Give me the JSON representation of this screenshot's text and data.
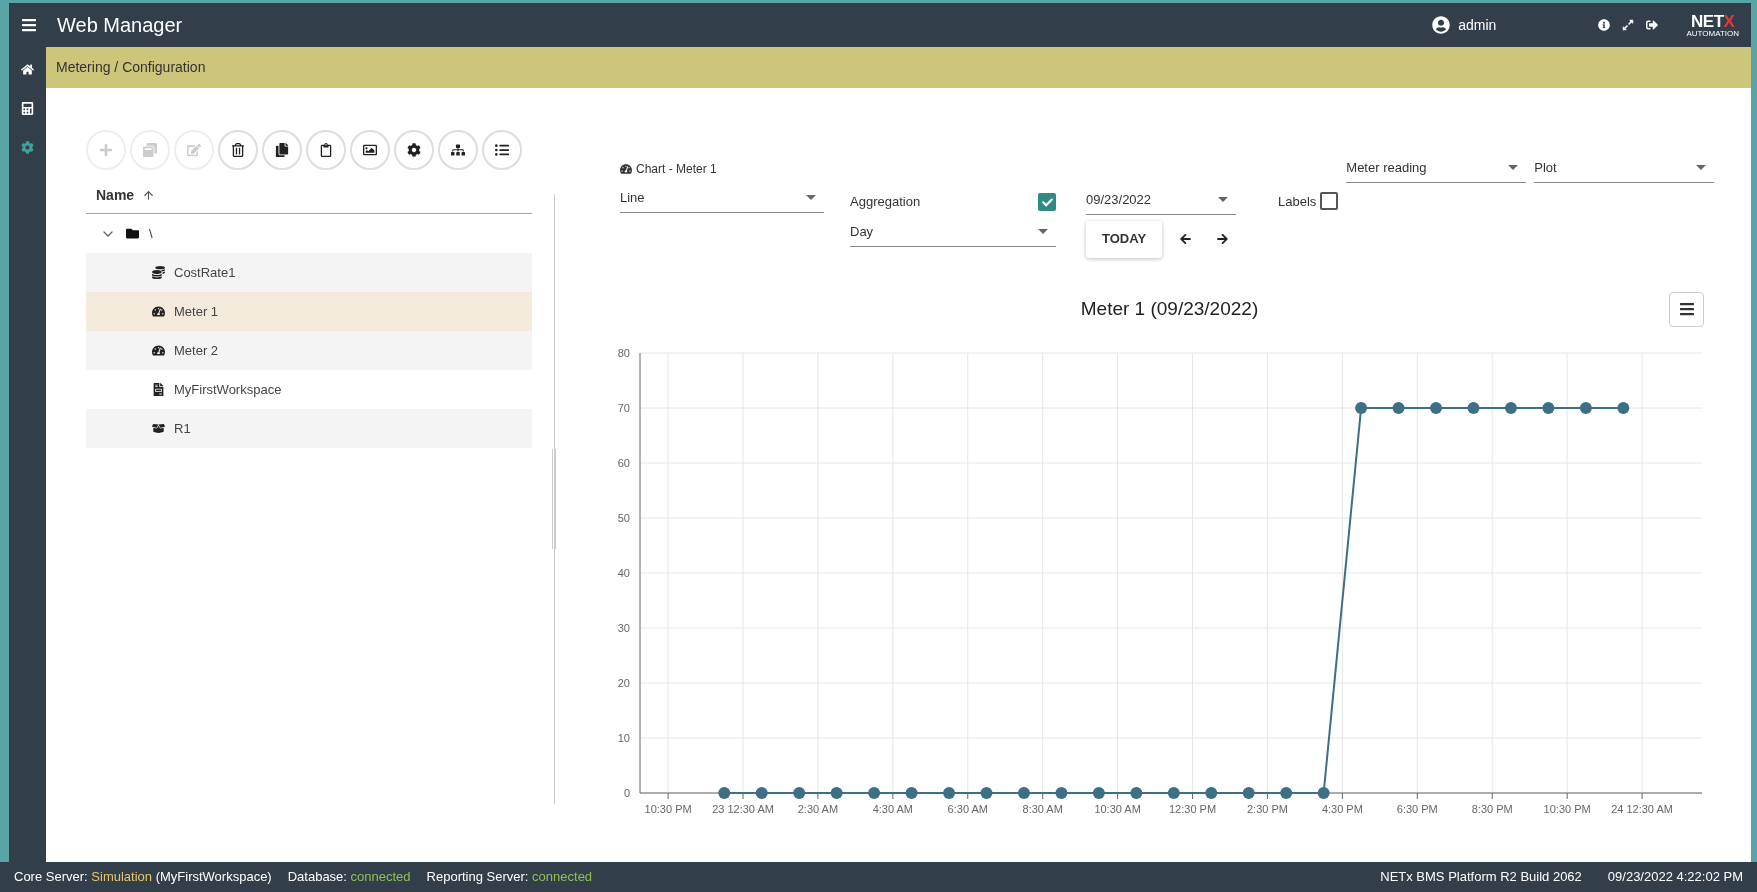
{
  "app_bar": {
    "title": "Web Manager",
    "user": "admin",
    "logo": {
      "name": "NET",
      "accent": "X",
      "tagline": "AUTOMATION"
    }
  },
  "sidebar": {
    "items": [
      {
        "kind": "home",
        "selected": false
      },
      {
        "kind": "calculator",
        "selected": false
      },
      {
        "kind": "settings",
        "selected": true
      }
    ]
  },
  "breadcrumb": "Metering / Configuration",
  "toolbar": {
    "buttons": [
      {
        "kind": "add",
        "disabled": true
      },
      {
        "kind": "duplicate",
        "disabled": true
      },
      {
        "kind": "edit",
        "disabled": true
      },
      {
        "kind": "delete",
        "disabled": false
      },
      {
        "kind": "copy",
        "disabled": false
      },
      {
        "kind": "paste",
        "disabled": false
      },
      {
        "kind": "image",
        "disabled": false
      },
      {
        "kind": "settings",
        "disabled": false
      },
      {
        "kind": "hierarchy",
        "disabled": false
      },
      {
        "kind": "list",
        "disabled": false
      }
    ]
  },
  "tree": {
    "column": "Name",
    "root": {
      "label": "\\",
      "expanded": true,
      "children": [
        {
          "label": "CostRate1",
          "kind": "cost",
          "selected": false
        },
        {
          "label": "Meter 1",
          "kind": "meter",
          "selected": true
        },
        {
          "label": "Meter 2",
          "kind": "meter",
          "selected": false
        },
        {
          "label": "MyFirstWorkspace",
          "kind": "workspace",
          "selected": false
        },
        {
          "label": "R1",
          "kind": "box",
          "selected": false
        }
      ]
    }
  },
  "chart_panel": {
    "title": "Chart - Meter 1",
    "chart_type": "Line",
    "aggregation": {
      "label": "Aggregation",
      "checked": true,
      "value": "Day"
    },
    "date": "09/23/2022",
    "today_button": "TODAY",
    "labels": {
      "label": "Labels",
      "checked": false
    },
    "value_select": "Meter reading",
    "mode_select": "Plot",
    "chart_data": {
      "type": "line",
      "title": "Meter 1 (09/23/2022)",
      "grid": true,
      "x": [
        "2022-09-23T00:00",
        "2022-09-23T01:00",
        "2022-09-23T02:00",
        "2022-09-23T03:00",
        "2022-09-23T04:00",
        "2022-09-23T05:00",
        "2022-09-23T06:00",
        "2022-09-23T07:00",
        "2022-09-23T08:00",
        "2022-09-23T09:00",
        "2022-09-23T10:00",
        "2022-09-23T11:00",
        "2022-09-23T12:00",
        "2022-09-23T13:00",
        "2022-09-23T14:00",
        "2022-09-23T15:00",
        "2022-09-23T16:00",
        "2022-09-23T17:00",
        "2022-09-23T18:00",
        "2022-09-23T19:00",
        "2022-09-23T20:00",
        "2022-09-23T21:00",
        "2022-09-23T22:00",
        "2022-09-23T23:00",
        "2022-09-24T00:00"
      ],
      "series": [
        {
          "color": "#3d6f87",
          "marker": "circle",
          "values": [
            0,
            0,
            0,
            0,
            0,
            0,
            0,
            0,
            0,
            0,
            0,
            0,
            0,
            0,
            0,
            0,
            0,
            70,
            70,
            70,
            70,
            70,
            70,
            70,
            70
          ]
        }
      ],
      "xlim": [
        "2022-09-22T21:45",
        "2022-09-24T02:06"
      ],
      "ylim": [
        0,
        80
      ],
      "xticks": [
        {
          "value": "2022-09-22T22:30",
          "label": "10:30 PM"
        },
        {
          "value": "2022-09-23T00:30",
          "label": "23 12:30 AM"
        },
        {
          "value": "2022-09-23T02:30",
          "label": "2:30 AM"
        },
        {
          "value": "2022-09-23T04:30",
          "label": "4:30 AM"
        },
        {
          "value": "2022-09-23T06:30",
          "label": "6:30 AM"
        },
        {
          "value": "2022-09-23T08:30",
          "label": "8:30 AM"
        },
        {
          "value": "2022-09-23T10:30",
          "label": "10:30 AM"
        },
        {
          "value": "2022-09-23T12:30",
          "label": "12:30 PM"
        },
        {
          "value": "2022-09-23T14:30",
          "label": "2:30 PM"
        },
        {
          "value": "2022-09-23T16:30",
          "label": "4:30 PM"
        },
        {
          "value": "2022-09-23T18:30",
          "label": "6:30 PM"
        },
        {
          "value": "2022-09-23T20:30",
          "label": "8:30 PM"
        },
        {
          "value": "2022-09-23T22:30",
          "label": "10:30 PM"
        },
        {
          "value": "2022-09-24T00:30",
          "label": "24 12:30 AM"
        }
      ],
      "yticks": [
        0,
        10,
        20,
        30,
        40,
        50,
        60,
        70,
        80
      ]
    }
  },
  "status_bar": {
    "items": [
      {
        "label": "Core Server:",
        "value": "Simulation",
        "extra": "(MyFirstWorkspace)",
        "color": "#e6c66a"
      },
      {
        "label": "Database:",
        "value": "connected",
        "color": "#8cc152"
      },
      {
        "label": "Reporting Server:",
        "value": "connected",
        "color": "#8cc152"
      }
    ],
    "build": "NETx BMS Platform R2 Build 2062",
    "datetime": "09/23/2022 4:22:02 PM"
  }
}
